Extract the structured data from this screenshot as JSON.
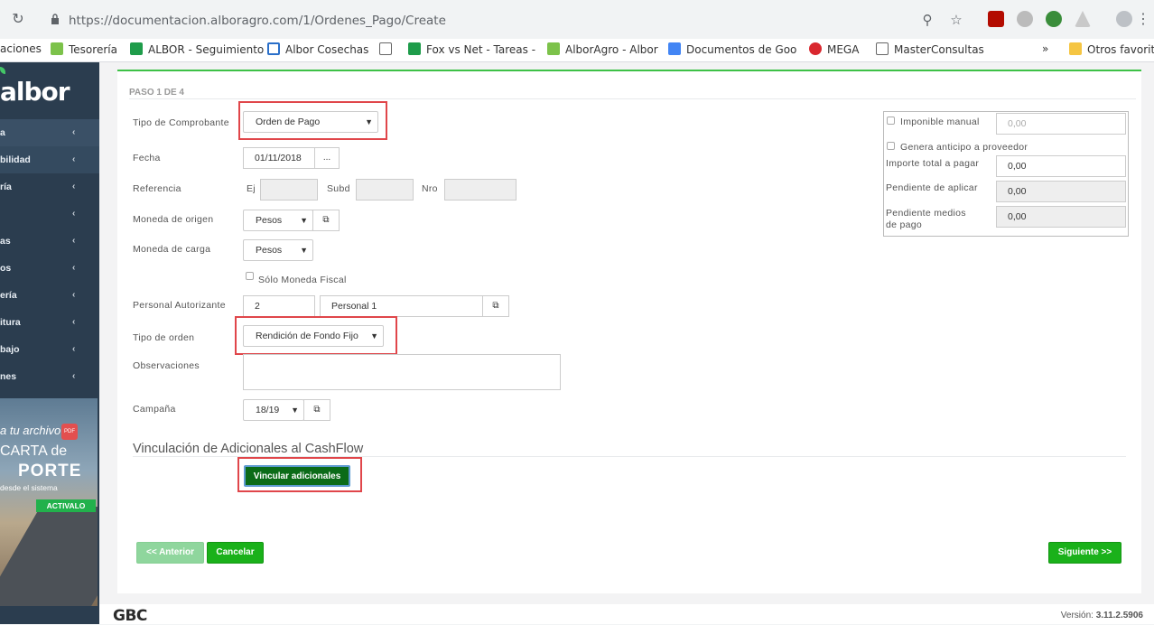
{
  "browser": {
    "url": "https://documentacion.alboragro.com/1/Ordenes_Pago/Create",
    "bookmarks": [
      "aciones",
      "Tesorería",
      "ALBOR - Seguimiento",
      "Albor Cosechas",
      "Fox vs Net - Tareas -",
      "AlborAgro - Albor",
      "Documentos de Goo",
      "MEGA",
      "MasterConsultas",
      "»",
      "Otros favorito"
    ]
  },
  "sidebar": {
    "logo": "albor",
    "items": [
      {
        "label": "a"
      },
      {
        "label": "bilidad"
      },
      {
        "label": "ría"
      },
      {
        "label": ""
      },
      {
        "label": "as"
      },
      {
        "label": "os"
      },
      {
        "label": "ería"
      },
      {
        "label": "itura"
      },
      {
        "label": "bajo"
      },
      {
        "label": "nes"
      }
    ],
    "ad": {
      "line1": "a tu archivo",
      "pdf": "PDF",
      "line2": "CARTA de",
      "line3": "PORTE",
      "line4": "desde el sistema",
      "badge": "ACTIVALO"
    }
  },
  "form": {
    "step": "PASO 1 DE 4",
    "tipo_comprobante": {
      "label": "Tipo de Comprobante",
      "value": "Orden de Pago"
    },
    "fecha": {
      "label": "Fecha",
      "value": "01/11/2018",
      "btn": "..."
    },
    "referencia": {
      "label": "Referencia",
      "ej": "Ej",
      "subd": "Subd",
      "nro": "Nro"
    },
    "moneda_origen": {
      "label": "Moneda de origen",
      "value": "Pesos"
    },
    "moneda_carga": {
      "label": "Moneda de carga",
      "value": "Pesos"
    },
    "solo_moneda_fiscal": "Sólo Moneda Fiscal",
    "personal": {
      "label": "Personal Autorizante",
      "code": "2",
      "name": "Personal 1"
    },
    "tipo_orden": {
      "label": "Tipo de orden",
      "value": "Rendición de Fondo Fijo"
    },
    "observaciones": {
      "label": "Observaciones",
      "value": ""
    },
    "campana": {
      "label": "Campaña",
      "value": "18/19"
    },
    "section_title": "Vinculación de Adicionales al CashFlow",
    "vincular_btn": "Vincular adicionales",
    "anterior_btn": "<< Anterior",
    "cancelar_btn": "Cancelar",
    "siguiente_btn": "Siguiente >>"
  },
  "right_box": {
    "imponible_manual": "Imponible manual",
    "imponible_value": "0,00",
    "genera_anticipo": "Genera anticipo a proveedor",
    "importe_total_label": "Importe total a pagar",
    "importe_total_value": "0,00",
    "pendiente_aplicar_label": "Pendiente de aplicar",
    "pendiente_aplicar_value": "0,00",
    "pendiente_medios_label": "Pendiente medios de pago",
    "pendiente_medios_value": "0,00"
  },
  "footer": {
    "brand": "GBC",
    "version_label": "Versión:",
    "version": "3.11.2.5906"
  },
  "colors": {
    "accent_green": "#1ab11a",
    "sidebar": "#2b3d4f",
    "highlight": "#e0464a"
  }
}
